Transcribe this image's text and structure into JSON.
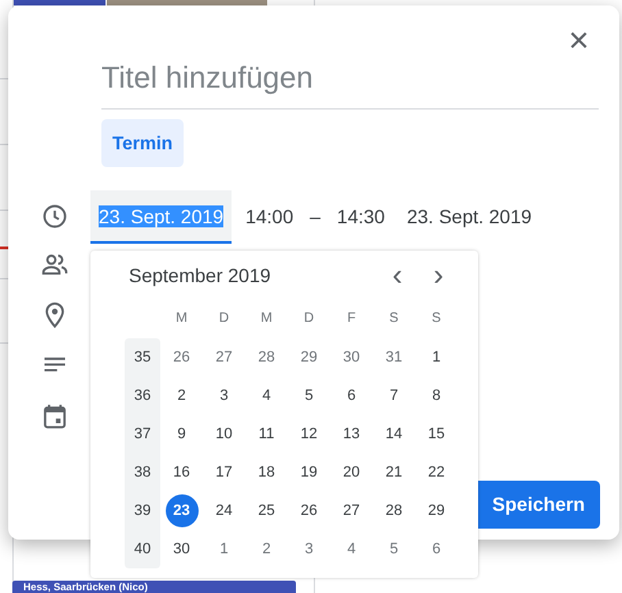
{
  "background_event": {
    "label": "Hess, Saarbrücken (Nico)",
    "color": "#3f51b5"
  },
  "dialog": {
    "close": "×",
    "title": {
      "placeholder": "Titel hinzufügen"
    },
    "types": [
      {
        "label": "Termin",
        "selected": true
      }
    ],
    "time_row": {
      "start_date": {
        "value": "23. Sept. 2019",
        "focused": true
      },
      "start_time": "14:00",
      "separator": "–",
      "end_time": "14:30",
      "end_date": "23. Sept. 2019"
    },
    "save_button": "Speichern"
  },
  "datepicker": {
    "month": "September 2019",
    "prev": "‹",
    "next": "›",
    "weekdays": [
      "M",
      "D",
      "M",
      "D",
      "F",
      "S",
      "S"
    ],
    "weeks": [
      {
        "week": "35",
        "days": [
          {
            "day": "26",
            "muted": true,
            "selected": false
          },
          {
            "day": "27",
            "muted": true,
            "selected": false
          },
          {
            "day": "28",
            "muted": true,
            "selected": false
          },
          {
            "day": "29",
            "muted": true,
            "selected": false
          },
          {
            "day": "30",
            "muted": true,
            "selected": false
          },
          {
            "day": "31",
            "muted": true,
            "selected": false
          },
          {
            "day": "1",
            "muted": false,
            "selected": false
          }
        ]
      },
      {
        "week": "36",
        "days": [
          {
            "day": "2",
            "muted": false,
            "selected": false
          },
          {
            "day": "3",
            "muted": false,
            "selected": false
          },
          {
            "day": "4",
            "muted": false,
            "selected": false
          },
          {
            "day": "5",
            "muted": false,
            "selected": false
          },
          {
            "day": "6",
            "muted": false,
            "selected": false
          },
          {
            "day": "7",
            "muted": false,
            "selected": false
          },
          {
            "day": "8",
            "muted": false,
            "selected": false
          }
        ]
      },
      {
        "week": "37",
        "days": [
          {
            "day": "9",
            "muted": false,
            "selected": false
          },
          {
            "day": "10",
            "muted": false,
            "selected": false
          },
          {
            "day": "11",
            "muted": false,
            "selected": false
          },
          {
            "day": "12",
            "muted": false,
            "selected": false
          },
          {
            "day": "13",
            "muted": false,
            "selected": false
          },
          {
            "day": "14",
            "muted": false,
            "selected": false
          },
          {
            "day": "15",
            "muted": false,
            "selected": false
          }
        ]
      },
      {
        "week": "38",
        "days": [
          {
            "day": "16",
            "muted": false,
            "selected": false
          },
          {
            "day": "17",
            "muted": false,
            "selected": false
          },
          {
            "day": "18",
            "muted": false,
            "selected": false
          },
          {
            "day": "19",
            "muted": false,
            "selected": false
          },
          {
            "day": "20",
            "muted": false,
            "selected": false
          },
          {
            "day": "21",
            "muted": false,
            "selected": false
          },
          {
            "day": "22",
            "muted": false,
            "selected": false
          }
        ]
      },
      {
        "week": "39",
        "days": [
          {
            "day": "23",
            "muted": false,
            "selected": true
          },
          {
            "day": "24",
            "muted": false,
            "selected": false
          },
          {
            "day": "25",
            "muted": false,
            "selected": false
          },
          {
            "day": "26",
            "muted": false,
            "selected": false
          },
          {
            "day": "27",
            "muted": false,
            "selected": false
          },
          {
            "day": "28",
            "muted": false,
            "selected": false
          },
          {
            "day": "29",
            "muted": false,
            "selected": false
          }
        ]
      },
      {
        "week": "40",
        "days": [
          {
            "day": "30",
            "muted": false,
            "selected": false
          },
          {
            "day": "1",
            "muted": true,
            "selected": false
          },
          {
            "day": "2",
            "muted": true,
            "selected": false
          },
          {
            "day": "3",
            "muted": true,
            "selected": false
          },
          {
            "day": "4",
            "muted": true,
            "selected": false
          },
          {
            "day": "5",
            "muted": true,
            "selected": false
          },
          {
            "day": "6",
            "muted": true,
            "selected": false
          }
        ]
      }
    ]
  }
}
